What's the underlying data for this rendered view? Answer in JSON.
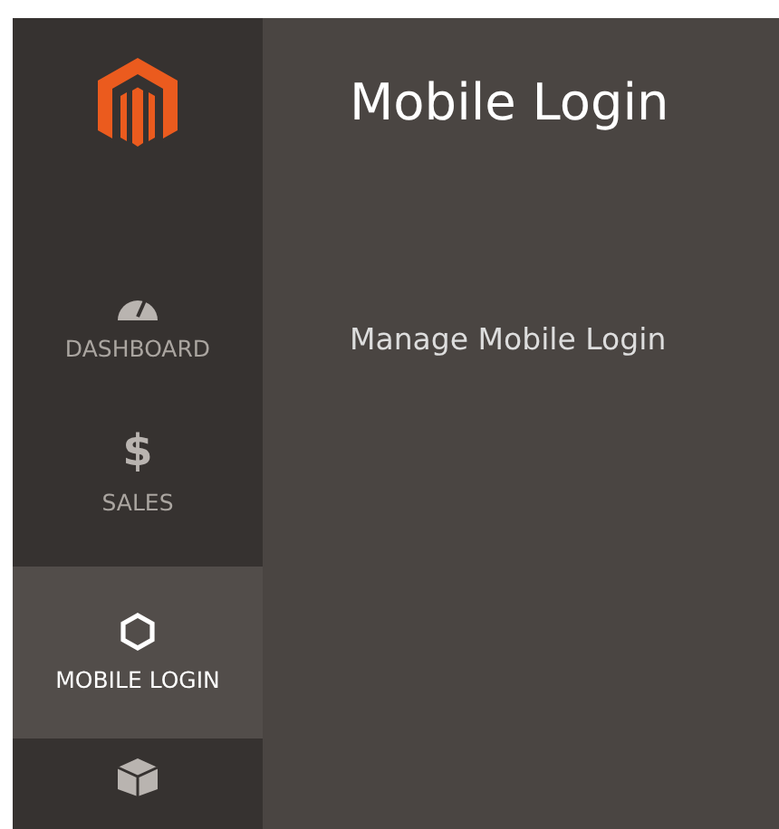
{
  "sidebar": {
    "items": [
      {
        "kind": "dashboard",
        "label": "DASHBOARD",
        "selected": false
      },
      {
        "kind": "sales",
        "icon": "$",
        "label": "SALES",
        "selected": false
      },
      {
        "kind": "hexagon",
        "label": "MOBILE LOGIN",
        "selected": true
      },
      {
        "kind": "box",
        "selected": false
      }
    ]
  },
  "page": {
    "title": "Mobile Login",
    "menu_item": "Manage Mobile Login"
  }
}
